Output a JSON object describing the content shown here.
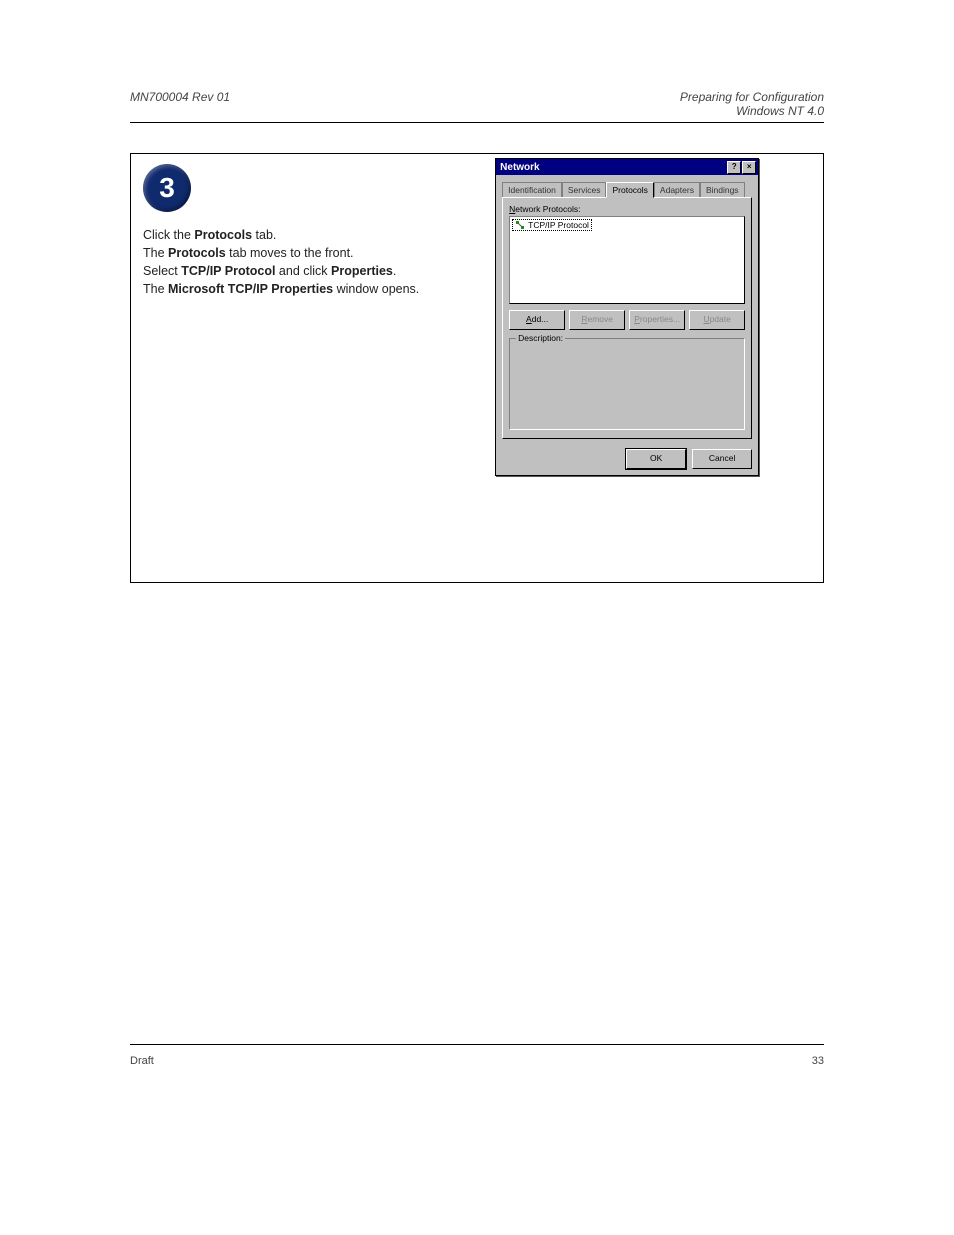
{
  "header": {
    "left": "MN700004 Rev 01",
    "right_title": "Preparing for Configuration",
    "right_sub": "Windows NT 4.0"
  },
  "step": {
    "number": "3",
    "pre": "Click the ",
    "bold1": "Protocols",
    "mid1": " tab.",
    "line2a": "The ",
    "line2b": "Protocols",
    "line2c": " tab moves to the front.",
    "line3a": "Select ",
    "line3b": "TCP/IP Protocol",
    "line3c": " and click ",
    "line3d": "Properties",
    "line3e": ".",
    "line4a": "The ",
    "line4b": "Microsoft TCP/IP Properties",
    "line4c": " window opens."
  },
  "dialog": {
    "title": "Network",
    "help_btn": "?",
    "close_btn": "×",
    "tabs": {
      "t1": "Identification",
      "t2": "Services",
      "t3": "Protocols",
      "t4": "Adapters",
      "t5": "Bindings"
    },
    "list_label_u": "N",
    "list_label_rest": "etwork Protocols:",
    "list_item": "TCP/IP Protocol",
    "buttons": {
      "add_u": "A",
      "add_rest": "dd...",
      "remove_u": "R",
      "remove_rest": "emove",
      "props_u": "P",
      "props_rest": "roperties...",
      "update_u": "U",
      "update_rest": "pdate"
    },
    "description_label": "Description:",
    "ok": "OK",
    "cancel": "Cancel"
  },
  "footer": {
    "left": "Draft",
    "right": "33"
  }
}
